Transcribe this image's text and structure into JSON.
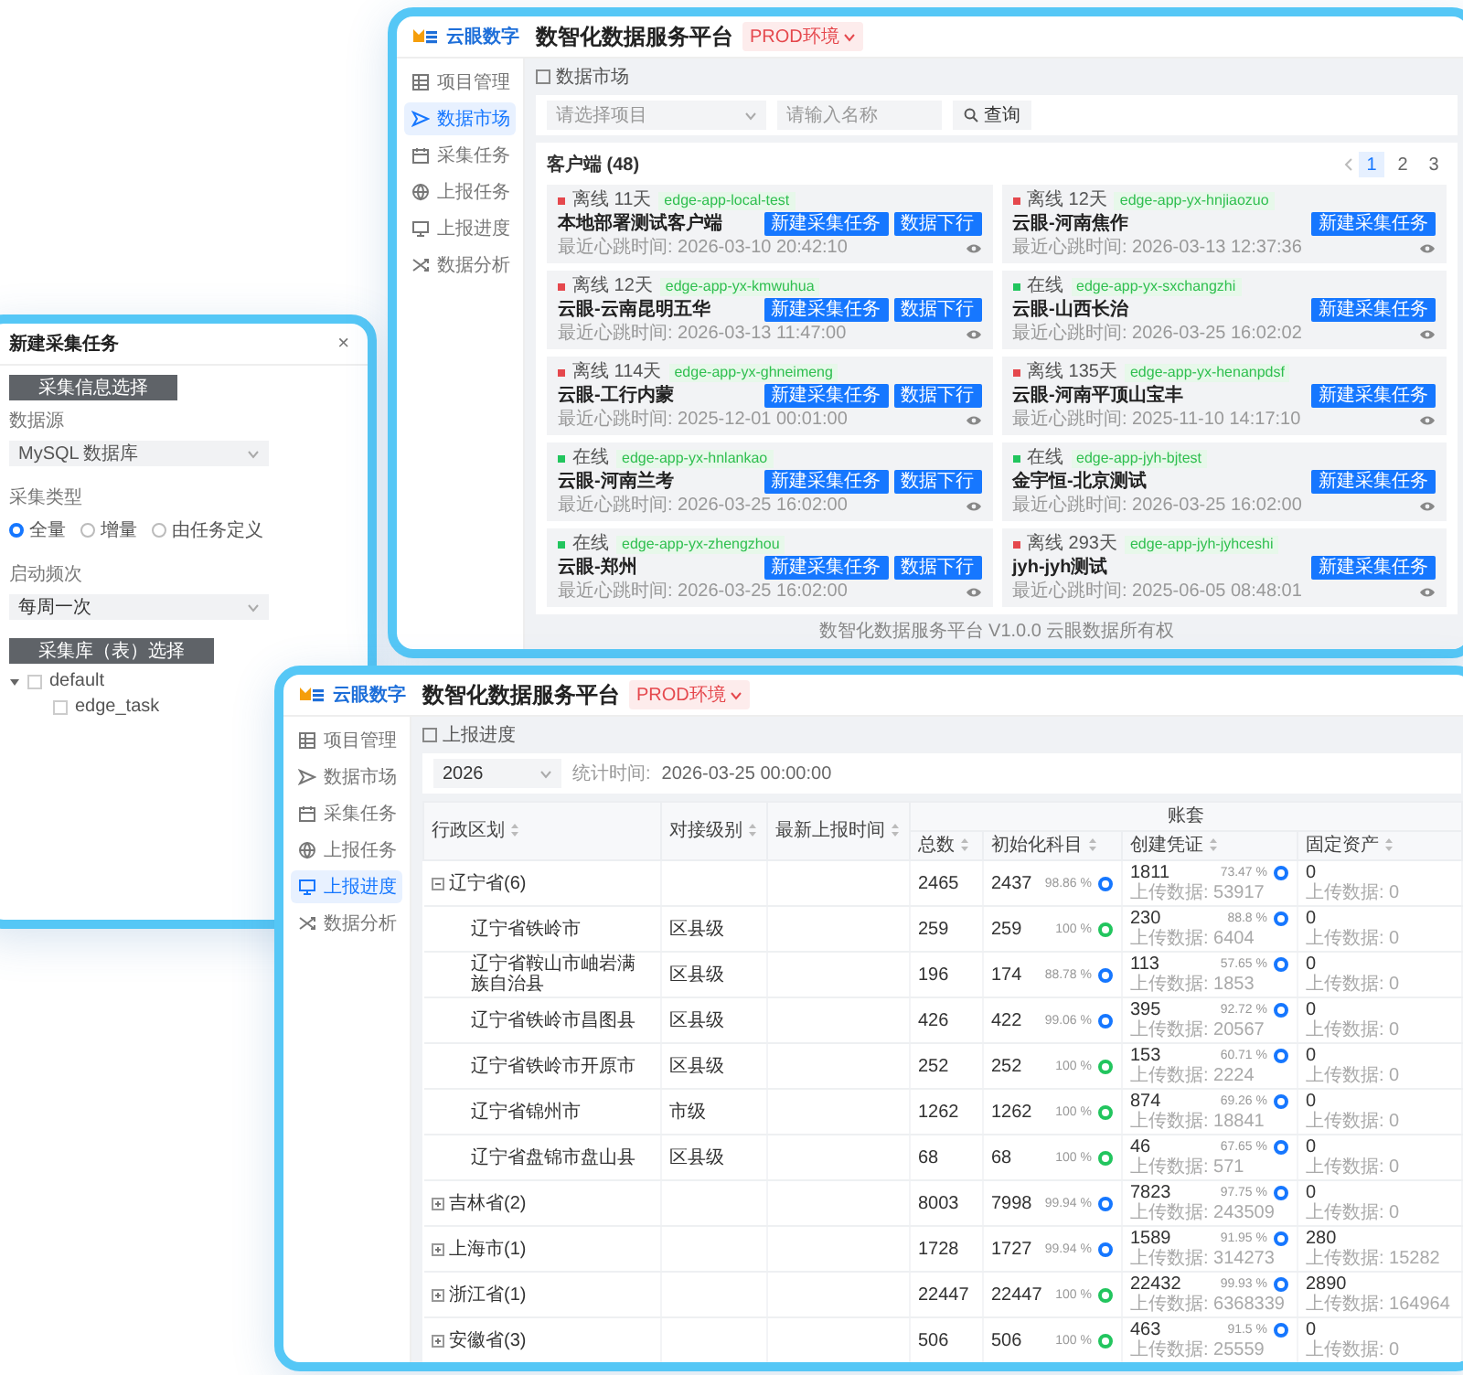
{
  "dialog": {
    "title": "新建采集任务",
    "close": "×",
    "info_button": "采集信息选择",
    "source": {
      "label": "数据源",
      "value": "MySQL 数据库"
    },
    "collect_type": {
      "label": "采集类型",
      "options": [
        {
          "label": "全量",
          "selected": true
        },
        {
          "label": "增量",
          "selected": false
        },
        {
          "label": "由任务定义",
          "selected": false
        }
      ]
    },
    "frequency": {
      "label": "启动频次",
      "value": "每周一次"
    },
    "table_button": "采集库（表）选择",
    "tree": [
      {
        "label": "default",
        "checked": false,
        "expanded": true,
        "children": [
          {
            "label": "edge_task",
            "checked": false
          }
        ]
      }
    ]
  },
  "market": {
    "logo": "云眼数字",
    "title": "数智化数据服务平台",
    "env_badge": "PROD环境",
    "sidebar": [
      {
        "label": "项目管理",
        "kind": "project",
        "selected": false
      },
      {
        "label": "数据市场",
        "kind": "market",
        "selected": true
      },
      {
        "label": "采集任务",
        "kind": "collect",
        "selected": false
      },
      {
        "label": "上报任务",
        "kind": "report",
        "selected": false
      },
      {
        "label": "上报进度",
        "kind": "progress",
        "selected": false
      },
      {
        "label": "数据分析",
        "kind": "analysis",
        "selected": false
      }
    ],
    "breadcrumb": "数据市场",
    "filters": {
      "project_placeholder": "请选择项目",
      "name_placeholder": "请输入名称",
      "query_button": "查询"
    },
    "panel_title": "客户端 (48)",
    "pages": [
      {
        "label": "1",
        "selected": true
      },
      {
        "label": "2",
        "selected": false
      },
      {
        "label": "3",
        "selected": false
      }
    ],
    "cards": [
      {
        "online": false,
        "status": "离线 11天",
        "tag": "edge-app-local-test",
        "name": "本地部署测试客户端",
        "heartbeat": "最近心跳时间: 2026-03-10 20:42:10",
        "buttons": [
          "新建采集任务",
          "数据下行"
        ]
      },
      {
        "online": false,
        "status": "离线 12天",
        "tag": "edge-app-yx-hnjiaozuo",
        "name": "云眼-河南焦作",
        "heartbeat": "最近心跳时间: 2026-03-13 12:37:36",
        "buttons": [
          "新建采集任务"
        ]
      },
      {
        "online": false,
        "status": "离线 12天",
        "tag": "edge-app-yx-kmwuhua",
        "name": "云眼-云南昆明五华",
        "heartbeat": "最近心跳时间: 2026-03-13 11:47:00",
        "buttons": [
          "新建采集任务",
          "数据下行"
        ]
      },
      {
        "online": true,
        "status": "在线",
        "tag": "edge-app-yx-sxchangzhi",
        "name": "云眼-山西长治",
        "heartbeat": "最近心跳时间: 2026-03-25 16:02:02",
        "buttons": [
          "新建采集任务"
        ]
      },
      {
        "online": false,
        "status": "离线 114天",
        "tag": "edge-app-yx-ghneimeng",
        "name": "云眼-工行内蒙",
        "heartbeat": "最近心跳时间: 2025-12-01 00:01:00",
        "buttons": [
          "新建采集任务",
          "数据下行"
        ]
      },
      {
        "online": false,
        "status": "离线 135天",
        "tag": "edge-app-yx-henanpdsf",
        "name": "云眼-河南平顶山宝丰",
        "heartbeat": "最近心跳时间: 2025-11-10 14:17:10",
        "buttons": [
          "新建采集任务"
        ]
      },
      {
        "online": true,
        "status": "在线",
        "tag": "edge-app-yx-hnlankao",
        "name": "云眼-河南兰考",
        "heartbeat": "最近心跳时间: 2026-03-25 16:02:00",
        "buttons": [
          "新建采集任务",
          "数据下行"
        ]
      },
      {
        "online": true,
        "status": "在线",
        "tag": "edge-app-jyh-bjtest",
        "name": "金宇恒-北京测试",
        "heartbeat": "最近心跳时间: 2026-03-25 16:02:00",
        "buttons": [
          "新建采集任务"
        ]
      },
      {
        "online": true,
        "status": "在线",
        "tag": "edge-app-yx-zhengzhou",
        "name": "云眼-郑州",
        "heartbeat": "最近心跳时间: 2026-03-25 16:02:00",
        "buttons": [
          "新建采集任务",
          "数据下行"
        ]
      },
      {
        "online": false,
        "status": "离线 293天",
        "tag": "edge-app-jyh-jyhceshi",
        "name": "jyh-jyh测试",
        "heartbeat": "最近心跳时间: 2025-06-05 08:48:01",
        "buttons": [
          "新建采集任务"
        ]
      }
    ],
    "footer": "数智化数据服务平台 V1.0.0 云眼数据所有权"
  },
  "progress": {
    "logo": "云眼数字",
    "title": "数智化数据服务平台",
    "env_badge": "PROD环境",
    "sidebar": [
      {
        "label": "项目管理",
        "kind": "project",
        "selected": false
      },
      {
        "label": "数据市场",
        "kind": "market",
        "selected": false
      },
      {
        "label": "采集任务",
        "kind": "collect",
        "selected": false
      },
      {
        "label": "上报任务",
        "kind": "report",
        "selected": false
      },
      {
        "label": "上报进度",
        "kind": "progress",
        "selected": true
      },
      {
        "label": "数据分析",
        "kind": "analysis",
        "selected": false
      }
    ],
    "breadcrumb": "上报进度",
    "year": "2026",
    "stat_label": "统计时间:",
    "stat_time": "2026-03-25 00:00:00",
    "table": {
      "columns": [
        "行政区划",
        "对接级别",
        "最新上报时间"
      ],
      "group_header": "账套",
      "group_columns": [
        "总数",
        "初始化科目",
        "创建凭证",
        "固定资产"
      ],
      "rows": [
        {
          "region": "辽宁省(6)",
          "expanded": true,
          "total": "2465",
          "init": {
            "value": "2437",
            "percent": "98.86 %",
            "color": "#1677ff"
          },
          "voucher": {
            "value": "1811",
            "percent": "73.47 %",
            "upload": "上传数据: 53917"
          },
          "asset": {
            "value": "0",
            "upload": "上传数据: 0"
          },
          "children": [
            {
              "region": "辽宁省铁岭市",
              "tier": "区县级",
              "total": "259",
              "init": {
                "value": "259",
                "percent": "100 %",
                "color": "#22c55e"
              },
              "voucher": {
                "value": "230",
                "percent": "88.8 %",
                "upload": "上传数据: 6404"
              },
              "asset": {
                "value": "0",
                "upload": "上传数据: 0"
              }
            },
            {
              "region": "辽宁省鞍山市岫岩满族自治县",
              "tier": "区县级",
              "total": "196",
              "init": {
                "value": "174",
                "percent": "88.78 %",
                "color": "#1677ff"
              },
              "voucher": {
                "value": "113",
                "percent": "57.65 %",
                "upload": "上传数据: 1853"
              },
              "asset": {
                "value": "0",
                "upload": "上传数据: 0"
              }
            },
            {
              "region": "辽宁省铁岭市昌图县",
              "tier": "区县级",
              "total": "426",
              "init": {
                "value": "422",
                "percent": "99.06 %",
                "color": "#1677ff"
              },
              "voucher": {
                "value": "395",
                "percent": "92.72 %",
                "upload": "上传数据: 20567"
              },
              "asset": {
                "value": "0",
                "upload": "上传数据: 0"
              }
            },
            {
              "region": "辽宁省铁岭市开原市",
              "tier": "区县级",
              "total": "252",
              "init": {
                "value": "252",
                "percent": "100 %",
                "color": "#22c55e"
              },
              "voucher": {
                "value": "153",
                "percent": "60.71 %",
                "upload": "上传数据: 2224"
              },
              "asset": {
                "value": "0",
                "upload": "上传数据: 0"
              }
            },
            {
              "region": "辽宁省锦州市",
              "tier": "市级",
              "total": "1262",
              "init": {
                "value": "1262",
                "percent": "100 %",
                "color": "#22c55e"
              },
              "voucher": {
                "value": "874",
                "percent": "69.26 %",
                "upload": "上传数据: 18841"
              },
              "asset": {
                "value": "0",
                "upload": "上传数据: 0"
              }
            },
            {
              "region": "辽宁省盘锦市盘山县",
              "tier": "区县级",
              "total": "68",
              "init": {
                "value": "68",
                "percent": "100 %",
                "color": "#22c55e"
              },
              "voucher": {
                "value": "46",
                "percent": "67.65 %",
                "upload": "上传数据: 571"
              },
              "asset": {
                "value": "0",
                "upload": "上传数据: 0"
              }
            }
          ]
        },
        {
          "region": "吉林省(2)",
          "expanded": false,
          "total": "8003",
          "init": {
            "value": "7998",
            "percent": "99.94 %",
            "color": "#1677ff"
          },
          "voucher": {
            "value": "7823",
            "percent": "97.75 %",
            "upload": "上传数据: 243509"
          },
          "asset": {
            "value": "0",
            "upload": "上传数据: 0"
          }
        },
        {
          "region": "上海市(1)",
          "expanded": false,
          "total": "1728",
          "init": {
            "value": "1727",
            "percent": "99.94 %",
            "color": "#1677ff"
          },
          "voucher": {
            "value": "1589",
            "percent": "91.95 %",
            "upload": "上传数据: 314273"
          },
          "asset": {
            "value": "280",
            "upload": "上传数据: 15282"
          }
        },
        {
          "region": "浙江省(1)",
          "expanded": false,
          "total": "22447",
          "init": {
            "value": "22447",
            "percent": "100 %",
            "color": "#22c55e"
          },
          "voucher": {
            "value": "22432",
            "percent": "99.93 %",
            "upload": "上传数据: 6368339"
          },
          "asset": {
            "value": "2890",
            "upload": "上传数据: 164964"
          }
        },
        {
          "region": "安徽省(3)",
          "expanded": false,
          "total": "506",
          "init": {
            "value": "506",
            "percent": "100 %",
            "color": "#22c55e"
          },
          "voucher": {
            "value": "463",
            "percent": "91.5 %",
            "upload": "上传数据: 25559"
          },
          "asset": {
            "value": "0",
            "upload": "上传数据: 0"
          }
        }
      ]
    }
  }
}
